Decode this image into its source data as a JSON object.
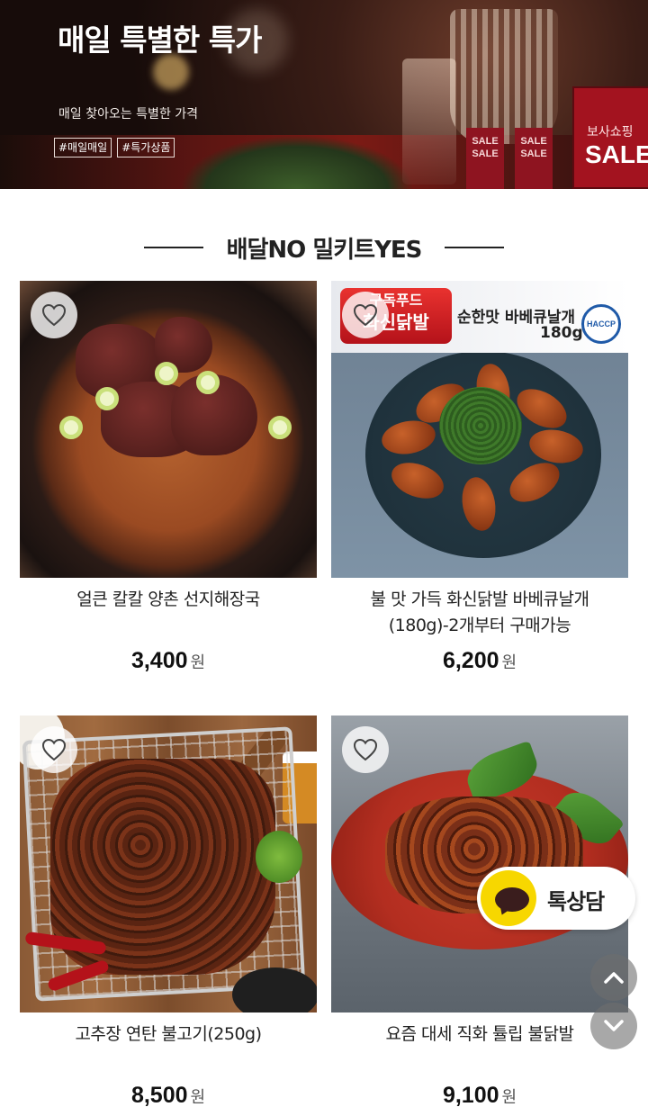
{
  "banner": {
    "title": "매일 특별한 특가",
    "subtitle": "매일 찾아오는 특별한 가격",
    "tags": [
      "#매일매일",
      "#특가상품"
    ],
    "sale_tag_text": "SALE SALE",
    "sale_board_small": "보사쇼핑",
    "sale_board_big": "SALE"
  },
  "section": {
    "title": "배달NO 밀키트YES"
  },
  "products": [
    {
      "name": "얼큰 칼칼 양촌 선지해장국",
      "price": "3,400",
      "currency": "원",
      "image": "blood-sausage-soup-photo"
    },
    {
      "name": "불 맛 가득 화신닭발 바베큐날개 (180g)-2개부터 구매가능",
      "price": "6,200",
      "currency": "원",
      "image": "bbq-wings-photo",
      "image_text": {
        "logo": "화신닭발",
        "logo_top": "구독푸드",
        "tagline": "순한맛 바베큐날개",
        "weight": "180g",
        "haccp": "HACCP"
      }
    },
    {
      "name": "고추장 연탄 불고기(250g)",
      "price": "8,500",
      "currency": "원",
      "image": "bulgogi-photo"
    },
    {
      "name": "요즘 대세 직화 튤립 불닭발",
      "price": "9,100",
      "currency": "원",
      "image": "spicy-chicken-feet-photo"
    }
  ],
  "floating": {
    "chat_label": "톡상담",
    "scroll_up": "chevron-up-icon",
    "scroll_down": "chevron-down-icon"
  },
  "icons": {
    "wishlist": "heart-icon",
    "chat": "kakao-chat-icon"
  },
  "colors": {
    "chat_yellow": "#f7d700",
    "sale_red": "#a3131f"
  }
}
